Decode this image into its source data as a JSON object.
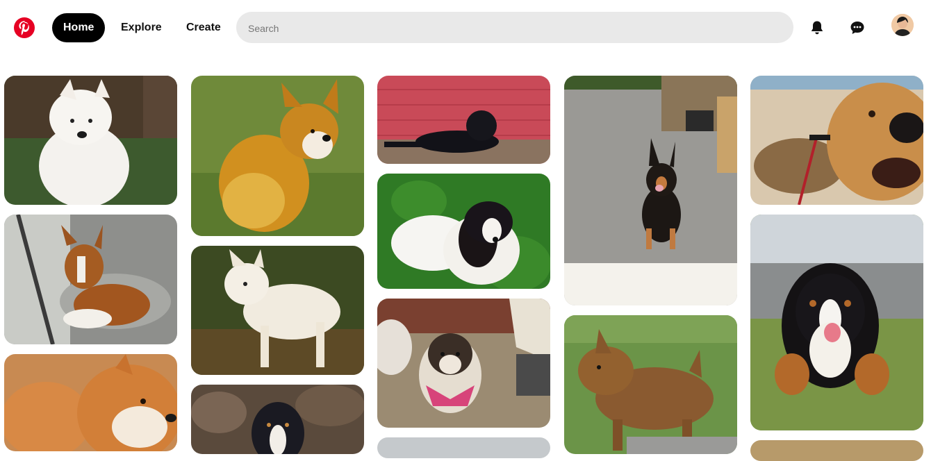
{
  "header": {
    "logo_name": "pinterest-logo",
    "nav": {
      "home_label": "Home",
      "explore_label": "Explore",
      "create_label": "Create"
    },
    "search": {
      "placeholder": "Search"
    },
    "icons": [
      "bell-icon",
      "chat-icon",
      "avatar"
    ]
  },
  "colors": {
    "brand": "#e60023",
    "active_nav_bg": "#000000",
    "search_bg": "#e9e9e9"
  },
  "feed": {
    "columns": [
      {
        "pins": [
          "white westie",
          "basenji on couch",
          "shiba inu"
        ]
      },
      {
        "pins": [
          "corgi on grass",
          "white shepherd",
          "tricolor puppy"
        ]
      },
      {
        "pins": [
          "black dog on wall",
          "papillon in leaves",
          "shih tzu with bandana",
          "dog"
        ]
      },
      {
        "pins": [
          "shepherd mix in garage",
          "norwich terrier"
        ]
      },
      {
        "pins": [
          "bloodhound close-up",
          "bernese puppy",
          "dog"
        ]
      }
    ]
  }
}
